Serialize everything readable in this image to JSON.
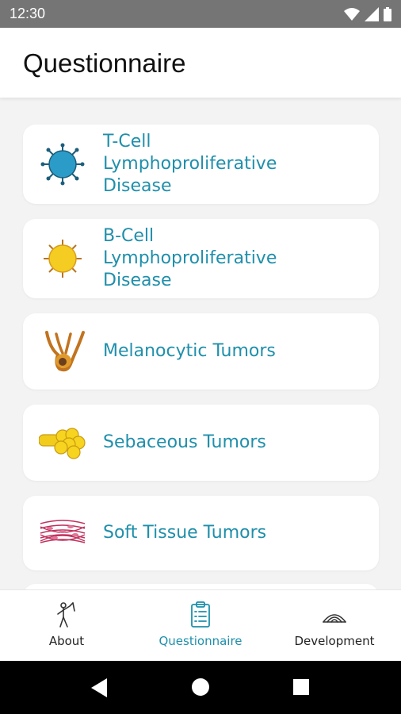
{
  "status_bar": {
    "time": "12:30"
  },
  "app_bar": {
    "title": "Questionnaire"
  },
  "categories": [
    {
      "label_line1": "T-Cell",
      "label_line2": "Lymphoproliferative",
      "label_line3": "Disease",
      "icon": "t-cell-icon"
    },
    {
      "label_line1": "B-Cell",
      "label_line2": "Lymphoproliferative",
      "label_line3": "Disease",
      "icon": "b-cell-icon"
    },
    {
      "label": "Melanocytic Tumors",
      "icon": "melanocyte-icon"
    },
    {
      "label": "Sebaceous Tumors",
      "icon": "sebaceous-gland-icon"
    },
    {
      "label": "Soft Tissue Tumors",
      "icon": "soft-tissue-icon"
    }
  ],
  "bottom_nav": {
    "items": [
      {
        "label": "About",
        "icon": "figure-icon"
      },
      {
        "label": "Questionnaire",
        "icon": "clipboard-icon",
        "active": true
      },
      {
        "label": "Development",
        "icon": "dome-icon"
      }
    ]
  },
  "colors": {
    "accent": "#1f8fab",
    "status_bar": "#757575",
    "background": "#f3f3f3"
  }
}
